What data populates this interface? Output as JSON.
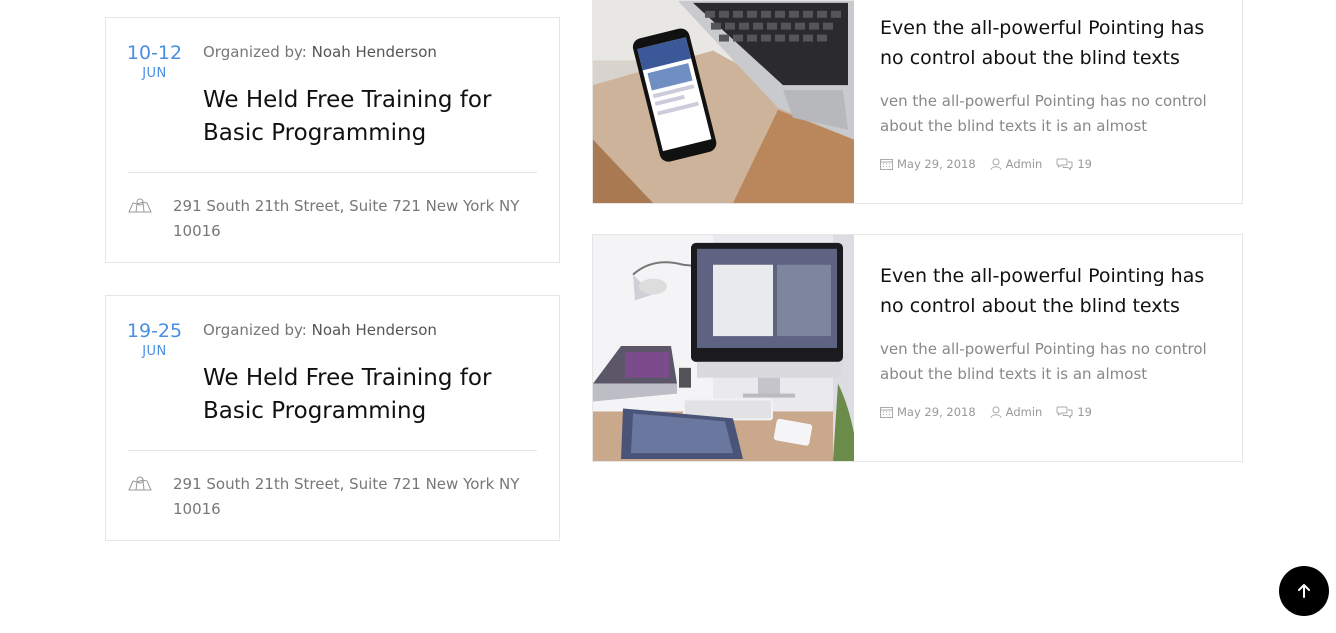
{
  "events": [
    {
      "date_range": "10-12",
      "month": "JUN",
      "organizer_label": "Organized by:",
      "organizer_name": "Noah Henderson",
      "title": "We Held Free Training for Basic Programming",
      "address": "291 South 21th Street, Suite 721 New York NY 10016"
    },
    {
      "date_range": "19-25",
      "month": "JUN",
      "organizer_label": "Organized by:",
      "organizer_name": "Noah Henderson",
      "title": "We Held Free Training for Basic Programming",
      "address": "291 South 21th Street, Suite 721 New York NY 10016"
    }
  ],
  "posts": [
    {
      "title": "Even the all-powerful Pointing has no control about the blind texts",
      "excerpt": "ven the all-powerful Pointing has no control about the blind texts it is an almost",
      "date": "May 29, 2018",
      "author": "Admin",
      "comments": "19",
      "image_icon": "laptop-phone-photo"
    },
    {
      "title": "Even the all-powerful Pointing has no control about the blind texts",
      "excerpt": "ven the all-powerful Pointing has no control about the blind texts it is an almost",
      "date": "May 29, 2018",
      "author": "Admin",
      "comments": "19",
      "image_icon": "imac-desk-photo"
    }
  ],
  "scroll_top_icon": "arrow-up-icon",
  "colors": {
    "accent": "#4a90e2",
    "scroll_button": "#000000"
  }
}
